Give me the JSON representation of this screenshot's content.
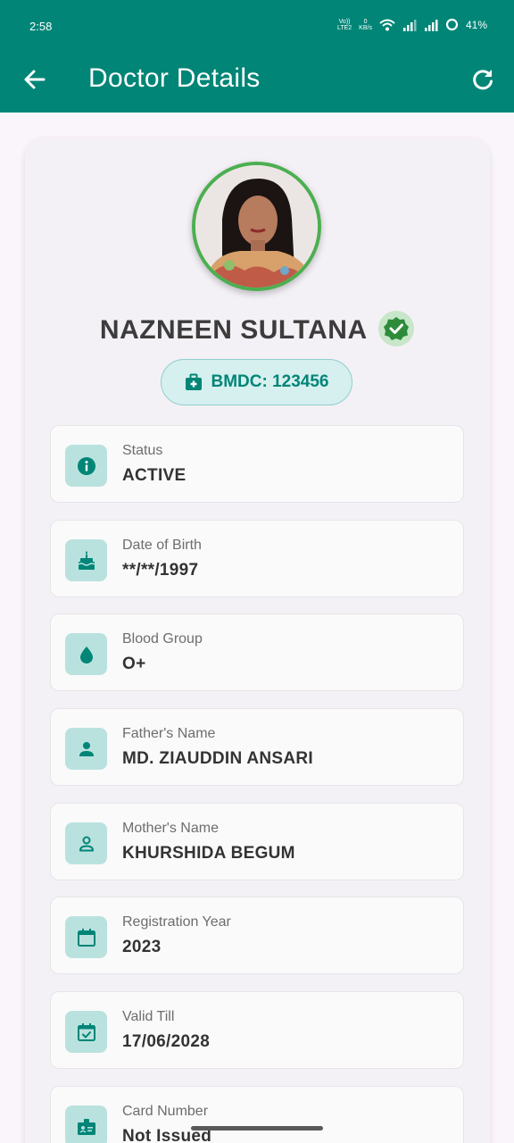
{
  "status_bar": {
    "time": "2:58",
    "volte": "Vo)) LTE2",
    "speed_value": "0",
    "speed_unit": "KB/s",
    "battery": "41%"
  },
  "app_bar": {
    "title": "Doctor Details",
    "back_icon": "arrow-left-icon",
    "refresh_icon": "refresh-icon"
  },
  "profile": {
    "name": "NAZNEEN SULTANA",
    "verified_icon": "verified-check-icon",
    "bmdc_label": "BMDC: 123456"
  },
  "details": [
    {
      "icon": "info-icon",
      "label": "Status",
      "value": "ACTIVE"
    },
    {
      "icon": "cake-icon",
      "label": "Date of Birth",
      "value": "**/**/1997"
    },
    {
      "icon": "blood-drop-icon",
      "label": "Blood Group",
      "value": "O+"
    },
    {
      "icon": "person-icon",
      "label": "Father's Name",
      "value": "MD. ZIAUDDIN ANSARI"
    },
    {
      "icon": "person-outline-icon",
      "label": "Mother's Name",
      "value": "KHURSHIDA BEGUM"
    },
    {
      "icon": "calendar-icon",
      "label": "Registration Year",
      "value": "2023"
    },
    {
      "icon": "calendar-check-icon",
      "label": "Valid Till",
      "value": "17/06/2028"
    },
    {
      "icon": "id-badge-icon",
      "label": "Card Number",
      "value": "Not Issued"
    }
  ],
  "colors": {
    "primary": "#008577",
    "accent_light": "#b9e2df",
    "verified_green": "#4caf50"
  }
}
